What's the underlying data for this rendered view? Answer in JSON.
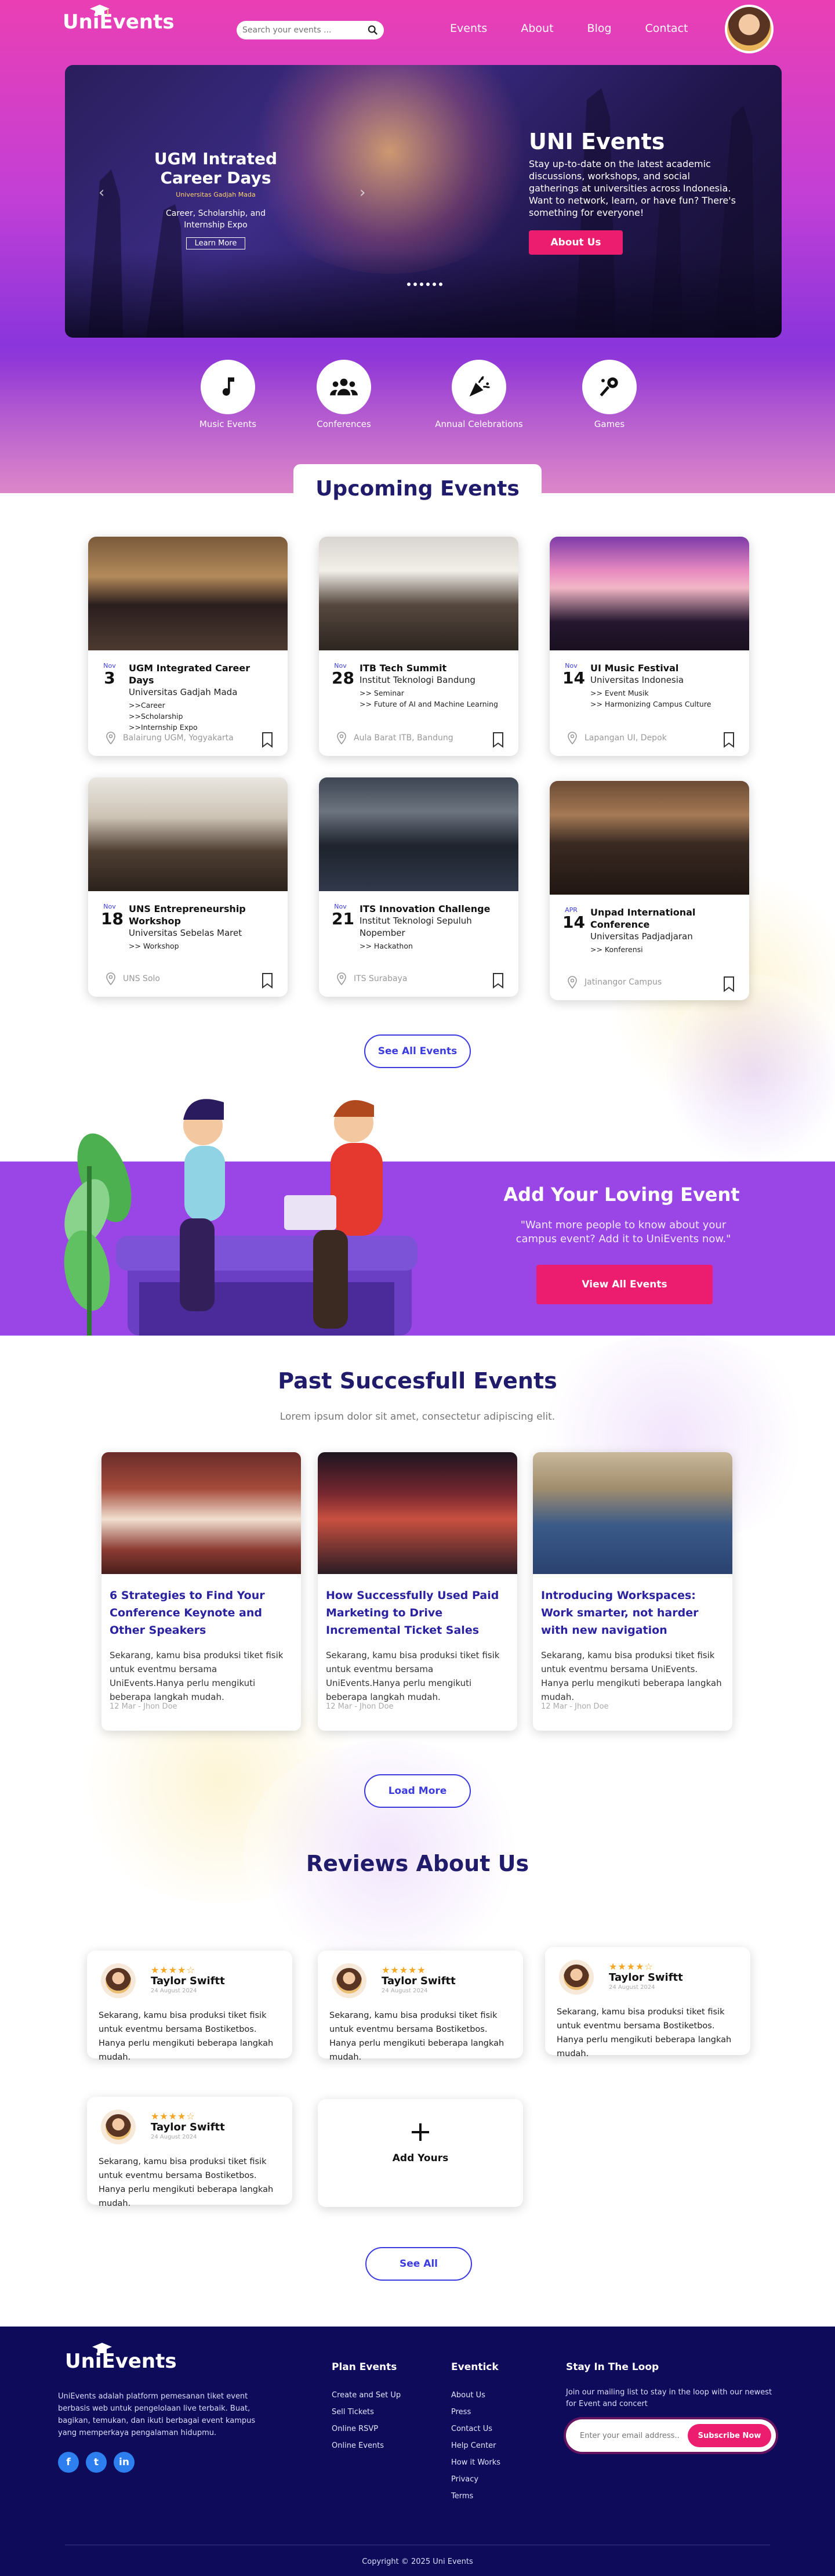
{
  "nav": {
    "logo_text": "UniEvents",
    "search_placeholder": "Search your events ...",
    "links": [
      "Events",
      "About",
      "Blog",
      "Contact"
    ]
  },
  "carousel": {
    "slide_title": "UGM Intrated Career Days",
    "slide_subtitle": "Universitas Gadjah Mada",
    "slide_desc": "Career, Scholarship, and Internship Expo",
    "learn_more": "Learn More",
    "info_title": "UNI Events",
    "info_text": "Stay up-to-date on the latest academic discussions, workshops, and social gatherings at universities across Indonesia. Want to network, learn, or have fun? There's something for everyone!",
    "about_button": "About Us"
  },
  "categories": [
    {
      "label": "Music Events",
      "icon": "music-note-icon"
    },
    {
      "label": "Conferences",
      "icon": "people-group-icon"
    },
    {
      "label": "Annual Celebrations",
      "icon": "party-popper-icon"
    },
    {
      "label": "Games",
      "icon": "game-icon"
    }
  ],
  "upcoming": {
    "title": "Upcoming Events",
    "see_all": "See All Events",
    "events": [
      {
        "month": "Nov",
        "day": "3",
        "title": "UGM Integrated Career Days",
        "org": "Universitas Gadjah Mada",
        "tags": [
          ">>Career",
          ">>Scholarship",
          ">>Internship Expo"
        ],
        "location": "Balairung UGM, Yogyakarta"
      },
      {
        "month": "Nov",
        "day": "28",
        "title": "ITB Tech Summit",
        "org": "Institut Teknologi Bandung",
        "tags": [
          ">> Seminar",
          ">> Future of AI and Machine Learning"
        ],
        "location": "Aula Barat ITB, Bandung"
      },
      {
        "month": "Nov",
        "day": "14",
        "title": "UI Music Festival",
        "org": "Universitas Indonesia",
        "tags": [
          ">> Event Musik",
          ">> Harmonizing Campus Culture"
        ],
        "location": "Lapangan UI, Depok"
      },
      {
        "month": "Nov",
        "day": "18",
        "title": "UNS Entrepreneurship Workshop",
        "org": "Universitas Sebelas Maret",
        "tags": [
          ">> Workshop"
        ],
        "location": "UNS Solo"
      },
      {
        "month": "Nov",
        "day": "21",
        "title": "ITS Innovation Challenge",
        "org": "Institut Teknologi Sepuluh Nopember",
        "tags": [
          ">> Hackathon"
        ],
        "location": "ITS Surabaya"
      },
      {
        "month": "APR",
        "day": "14",
        "title": "Unpad International Conference",
        "org": "Universitas Padjadjaran",
        "tags": [
          ">> Konferensi"
        ],
        "location": "Jatinangor Campus"
      }
    ]
  },
  "promo": {
    "title": "Add Your Loving Event",
    "text": "\"Want more people to know about your campus event? Add it to UniEvents now.\"",
    "button": "View All Events"
  },
  "past": {
    "title": "Past Succesfull Events",
    "subtitle": "Lorem ipsum dolor sit amet, consectetur adipiscing elit.",
    "load_more": "Load More",
    "items": [
      {
        "title": "6 Strategies to Find Your Conference Keynote and Other Speakers",
        "text": "Sekarang, kamu bisa produksi tiket fisik untuk eventmu bersama UniEvents.Hanya perlu mengikuti beberapa langkah mudah.",
        "meta": "12 Mar - Jhon Doe"
      },
      {
        "title": "How Successfully Used Paid Marketing to Drive Incremental Ticket Sales",
        "text": "Sekarang, kamu bisa produksi tiket fisik untuk eventmu bersama UniEvents.Hanya perlu mengikuti beberapa langkah mudah.",
        "meta": "12 Mar - Jhon Doe"
      },
      {
        "title": "Introducing Workspaces: Work smarter, not harder with new navigation",
        "text": "Sekarang, kamu bisa produksi tiket fisik untuk eventmu bersama UniEvents. Hanya perlu mengikuti beberapa langkah mudah.",
        "meta": "12 Mar - Jhon Doe"
      }
    ]
  },
  "reviews": {
    "title": "Reviews About Us",
    "see_all": "See All",
    "add_label": "Add Yours",
    "items": [
      {
        "name": "Taylor Swiftt",
        "date": "24 August 2024",
        "stars": "★★★★☆",
        "text": "Sekarang, kamu bisa produksi tiket fisik untuk eventmu bersama Bostiketbos. Hanya perlu mengikuti beberapa langkah mudah."
      },
      {
        "name": "Taylor Swiftt",
        "date": "24 August 2024",
        "stars": "★★★★★",
        "text": "Sekarang, kamu bisa produksi tiket fisik untuk eventmu bersama Bostiketbos. Hanya perlu mengikuti beberapa langkah mudah."
      },
      {
        "name": "Taylor Swiftt",
        "date": "24 August 2024",
        "stars": "★★★★☆",
        "text": "Sekarang, kamu bisa produksi tiket fisik untuk eventmu bersama Bostiketbos. Hanya perlu mengikuti beberapa langkah mudah."
      },
      {
        "name": "Taylor Swiftt",
        "date": "24 August 2024",
        "stars": "★★★★☆",
        "text": "Sekarang, kamu bisa produksi tiket fisik untuk eventmu bersama Bostiketbos. Hanya perlu mengikuti beberapa langkah mudah."
      }
    ]
  },
  "footer": {
    "logo_text": "UniEvents",
    "about": "UniEvents adalah platform pemesanan tiket event berbasis web untuk pengelolaan live terbaik. Buat, bagikan, temukan, dan ikuti berbagai event kampus yang memperkaya pengalaman hidupmu.",
    "social": [
      "f",
      "t",
      "in"
    ],
    "plan_title": "Plan Events",
    "plan_links": [
      "Create and Set Up",
      "Sell Tickets",
      "Online RSVP",
      "Online Events"
    ],
    "eventick_title": "Eventick",
    "eventick_links": [
      "About Us",
      "Press",
      "Contact Us",
      "Help Center",
      "How it Works",
      "Privacy",
      "Terms"
    ],
    "loop_title": "Stay In The Loop",
    "loop_text": "Join our mailing list to stay in the loop with our newest for Event and concert",
    "email_placeholder": "Enter your email address..",
    "subscribe": "Subscribe Now",
    "copyright": "Copyright © 2025 Uni Events"
  },
  "colors": {
    "accent": "#ec1d6f",
    "primary": "#3a3adf",
    "footer_bg": "#0e0c5a",
    "promo_bg": "#9a46e6"
  }
}
